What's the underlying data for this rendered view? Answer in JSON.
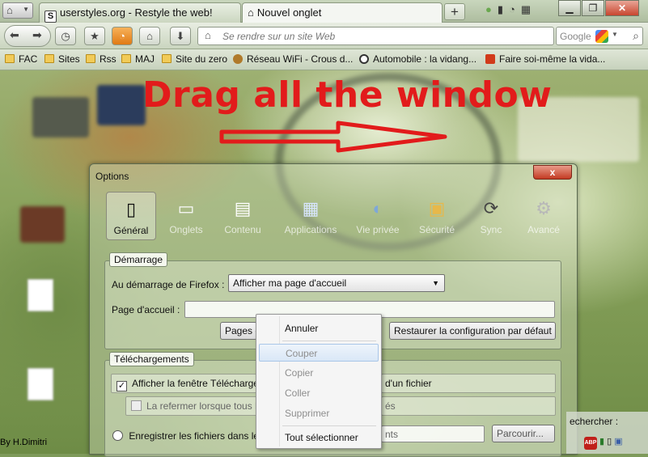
{
  "browser": {
    "tabs": [
      {
        "label": "userstyles.org - Restyle the web!",
        "icon": "userstyles-icon"
      },
      {
        "label": "Nouvel onglet",
        "icon": "home-icon"
      }
    ],
    "new_tab_label": "+",
    "address_placeholder": "Se rendre sur un site Web",
    "search_engine": "Google"
  },
  "bookmarks": [
    {
      "label": "FAC",
      "type": "folder"
    },
    {
      "label": "Sites",
      "type": "folder"
    },
    {
      "label": "Rss",
      "type": "folder"
    },
    {
      "label": "MAJ",
      "type": "folder"
    },
    {
      "label": "Site du zero",
      "type": "folder"
    },
    {
      "label": "Réseau WiFi - Crous d...",
      "type": "link",
      "color": "#b07a2a"
    },
    {
      "label": "Automobile : la vidang...",
      "type": "link",
      "color": "#333333"
    },
    {
      "label": "Faire soi-même la vida...",
      "type": "link",
      "color": "#d13a1a"
    }
  ],
  "annotation": {
    "text": "Drag all the window",
    "color": "#e21b1b"
  },
  "dialog": {
    "title": "Options",
    "close_label": "x",
    "categories": [
      {
        "label": "Général",
        "icon": "switch-icon",
        "selected": true
      },
      {
        "label": "Onglets",
        "icon": "tabs-icon",
        "selected": false
      },
      {
        "label": "Contenu",
        "icon": "content-icon",
        "selected": false
      },
      {
        "label": "Applications",
        "icon": "applications-icon",
        "selected": false
      },
      {
        "label": "Vie privée",
        "icon": "mask-icon",
        "selected": false
      },
      {
        "label": "Sécurité",
        "icon": "lock-icon",
        "selected": false
      },
      {
        "label": "Sync",
        "icon": "sync-icon",
        "selected": false
      },
      {
        "label": "Avancé",
        "icon": "gear-icon",
        "selected": false
      }
    ],
    "startup": {
      "group_title": "Démarrage",
      "at_start_label": "Au démarrage de Firefox :",
      "at_start_value": "Afficher ma page d'accueil",
      "homepage_label": "Page d'accueil :",
      "homepage_value": "",
      "current_pages_button": "Pages c",
      "restore_button": "Restaurer la configuration par défaut"
    },
    "downloads": {
      "group_title": "Téléchargements",
      "show_window_label_a": "Afficher la fenêtre Télécharger",
      "show_window_label_b": "d'un fichier",
      "show_window_checked": true,
      "close_when_label_a": "La refermer lorsque tous le",
      "close_when_label_b": "és",
      "save_files_label": "Enregistrer les fichiers dans le",
      "save_files_value_tail": "nts",
      "browse_button": "Parcourir..."
    }
  },
  "context_menu": {
    "items": [
      {
        "label": "Annuler",
        "disabled": false,
        "highlighted": false
      },
      {
        "label": "Couper",
        "disabled": true,
        "highlighted": true
      },
      {
        "label": "Copier",
        "disabled": true,
        "highlighted": false
      },
      {
        "label": "Coller",
        "disabled": true,
        "highlighted": false
      },
      {
        "label": "Supprimer",
        "disabled": true,
        "highlighted": false
      },
      {
        "label": "Tout sélectionner",
        "disabled": false,
        "highlighted": false
      }
    ]
  },
  "desktop": {
    "credit": "By H.Dimitri",
    "taskbar_label": "echercher :",
    "abp_label": "ABP"
  }
}
